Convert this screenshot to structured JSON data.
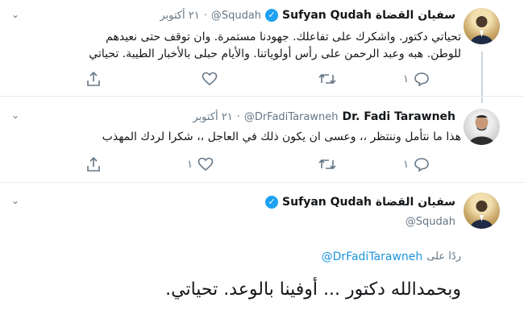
{
  "tweets": [
    {
      "name_ar": "سفيان القضاة",
      "name_en": "Sufyan Qudah",
      "handle": "@Squdah",
      "date": "٢١ أكتوبر",
      "sep": "·",
      "lines": [
        "تحياتي دكتور. واشكرك على تفاعلك. جهودنا مستمرة.  وان توقف حتى نعيدهم",
        "للوطن. هبه وعبد الرحمن على رأس أولوياتنا. والأيام حبلى بالأخبار الطيبة. تحياتي"
      ],
      "reply_count": "١"
    },
    {
      "name": "Dr. Fadi Tarawneh",
      "handle": "@DrFadiTarawneh",
      "date": "٢١ أكتوبر",
      "sep": "·",
      "lines": [
        "هذا ما نتأمل وننتظر ،، وعسى ان يكون ذلك في العاجل ،، شكرا لردك المهذب"
      ],
      "reply_count": "١",
      "like_count": "١"
    }
  ],
  "main_tweet": {
    "name_ar": "سفيان القضاة",
    "name_en": "Sufyan Qudah",
    "handle": "@Squdah",
    "reply_prefix": "ردًا على",
    "reply_to": "@DrFadiTarawneh",
    "text": "وبحمدالله دكتور ... أوفينا بالوعد. تحياتي."
  },
  "icons": {
    "caret": "chevron-down-icon",
    "verified": "verified-badge-icon",
    "reply": "reply-icon",
    "retweet": "retweet-icon",
    "like": "heart-icon",
    "share": "share-icon"
  },
  "colors": {
    "link": "#1b95e0",
    "verified": "#1da1f2",
    "muted": "#657786"
  }
}
